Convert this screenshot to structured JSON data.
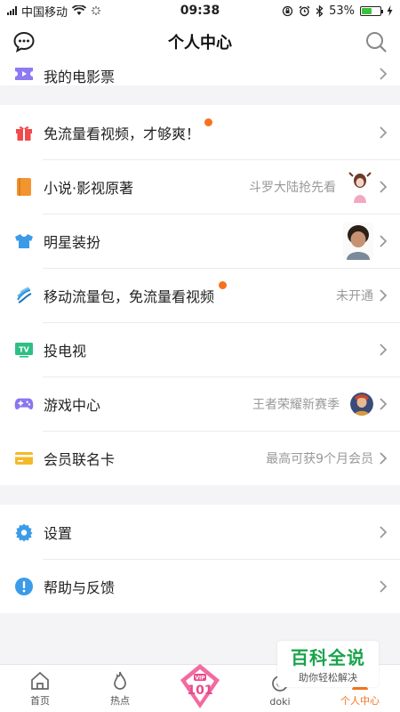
{
  "status_bar": {
    "carrier": "中国移动",
    "time": "09:38",
    "battery": "53%",
    "battery_level": 0.53
  },
  "header": {
    "title": "个人中心",
    "left_icon": "message-bubble-icon",
    "right_icon": "search-icon"
  },
  "menu": {
    "movie_tickets": "我的电影票",
    "free_data_video": "免流量看视频，才够爽！",
    "novels": {
      "label": "小说·影视原著",
      "hint": "斗罗大陆抢先看"
    },
    "star_dressup": "明星装扮",
    "mobile_data": {
      "label": "移动流量包，免流量看视频",
      "hint": "未开通"
    },
    "cast_tv": "投电视",
    "game_center": {
      "label": "游戏中心",
      "hint": "王者荣耀新赛季"
    },
    "member_card": {
      "label": "会员联名卡",
      "hint": "最高可获9个月会员"
    },
    "settings": "设置",
    "help_feedback": "帮助与反馈"
  },
  "tabs": {
    "home": "首页",
    "hot": "热点",
    "vip": "101",
    "doki": "doki",
    "profile": "个人中心"
  },
  "watermark": {
    "title": "百科全说",
    "subtitle": "助你轻松解决"
  },
  "colors": {
    "accent": "#f5731f",
    "watermark_green": "#1aa34a"
  }
}
